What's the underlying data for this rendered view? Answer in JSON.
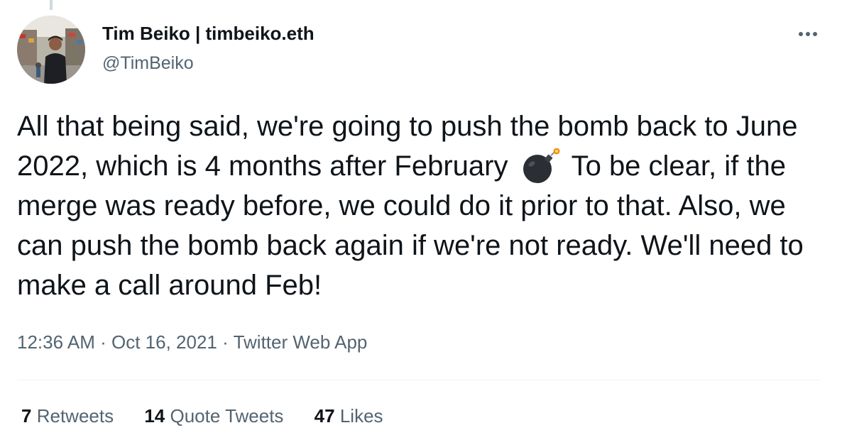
{
  "author": {
    "display_name": "Tim Beiko | timbeiko.eth",
    "handle": "@TimBeiko",
    "avatar_icon": "avatar-photo"
  },
  "tweet": {
    "text_part1": "All that being said, we're going to push the bomb back to June 2022, which is 4 months after February",
    "emoji": "bomb-icon",
    "text_part2": "To be clear, if the merge was ready before, we could do it prior to that. Also, we can push the bomb back again if we're not ready. We'll need to make a call around Feb!"
  },
  "meta": {
    "time": "12:36 AM",
    "sep1": "·",
    "date": "Oct 16, 2021",
    "sep2": "·",
    "source": "Twitter Web App"
  },
  "stats": {
    "retweets_count": "7",
    "retweets_label": "Retweets",
    "quotes_count": "14",
    "quotes_label": "Quote Tweets",
    "likes_count": "47",
    "likes_label": "Likes"
  },
  "colors": {
    "text_primary": "#0f1419",
    "text_secondary": "#536471",
    "divider": "#eff3f4"
  }
}
